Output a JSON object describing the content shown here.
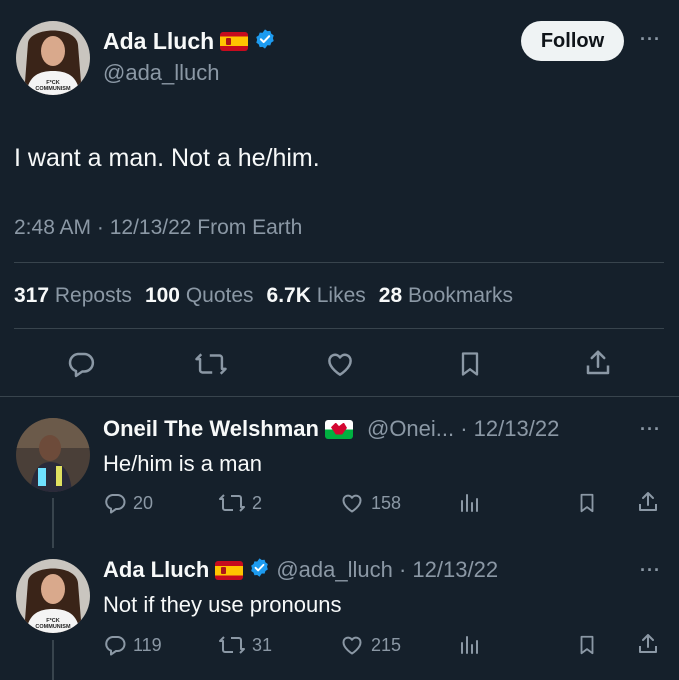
{
  "main_tweet": {
    "author_name": "Ada Lluch",
    "author_handle": "@ada_lluch",
    "follow_label": "Follow",
    "text": "I want a man. Not a he/him.",
    "timestamp": "2:48 AM · 12/13/22 From Earth",
    "stats": {
      "reposts_value": "317",
      "reposts_label": "Reposts",
      "quotes_value": "100",
      "quotes_label": "Quotes",
      "likes_value": "6.7K",
      "likes_label": "Likes",
      "bookmarks_value": "28",
      "bookmarks_label": "Bookmarks"
    },
    "avatar_shirt_text": "F*CK COMMUNISM"
  },
  "replies": [
    {
      "author_name": "Oneil The Welshman",
      "handle_date": "@Onei... · 12/13/22",
      "text": "He/him is a man",
      "replies_count": "20",
      "reposts_count": "2",
      "likes_count": "158"
    },
    {
      "author_name": "Ada Lluch",
      "handle_date": "@ada_lluch · 12/13/22",
      "text": "Not if they use pronouns",
      "replies_count": "119",
      "reposts_count": "31",
      "likes_count": "215"
    }
  ],
  "colors": {
    "background": "#15202b",
    "text": "#f7f9f9",
    "muted": "#8b98a5",
    "divider": "#38444d",
    "verified": "#1d9bf0"
  },
  "icons": [
    "more-icon",
    "verified-icon",
    "spain-flag-icon",
    "wales-flag-icon",
    "reply-icon",
    "repost-icon",
    "like-icon",
    "bookmark-icon",
    "share-icon",
    "views-icon"
  ]
}
